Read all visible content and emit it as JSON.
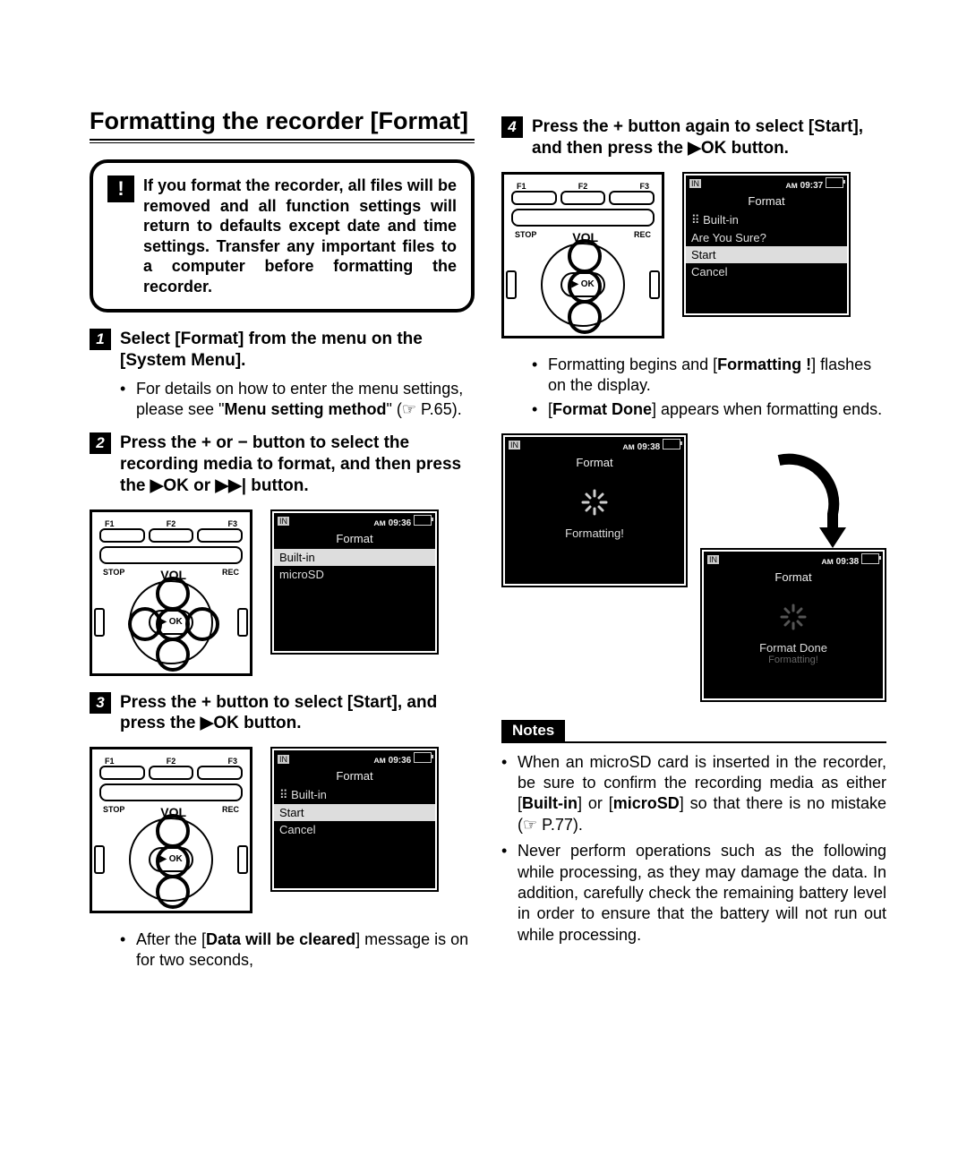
{
  "title": "Formatting the recorder [Format]",
  "warning_icon": "!",
  "warning": "If you format the recorder, all files will be removed and all function settings will return to defaults except date and time settings. Transfer any important files to a computer before formatting the recorder.",
  "steps": {
    "s1": {
      "num": "1",
      "text_parts": [
        "Select [",
        "Format",
        "] from the menu on the [",
        "System Menu",
        "]."
      ],
      "bullet_parts": [
        "For details on how to enter the menu settings, please see \"",
        "Menu setting method",
        "\" (☞ P.65)."
      ]
    },
    "s2": {
      "num": "2",
      "text_pre": "Press the + or − button to select the recording media to format, and then press the ",
      "text_ok": "OK",
      "text_mid": " or ",
      "text_post": " button."
    },
    "s3": {
      "num": "3",
      "text_pre": "Press the + button to select [Start], and press the ",
      "text_ok": "OK",
      "text_post": " button.",
      "bullet_parts": [
        "After the [",
        "Data will be cleared",
        "] message is on for two seconds,"
      ]
    },
    "s4": {
      "num": "4",
      "text_pre": "Press the + button again to select [Start], and then press the ",
      "text_ok": "OK",
      "text_post": " button.",
      "bullet1_parts": [
        "Formatting begins and [",
        "Formatting !",
        "] flashes on the display."
      ],
      "bullet2_parts": [
        "[",
        "Format Done",
        "] appears when formatting ends."
      ]
    }
  },
  "device": {
    "f1": "F1",
    "f2": "F2",
    "f3": "F3",
    "stop": "STOP",
    "rec": "REC",
    "vol": "VOL",
    "ok": "▶ OK"
  },
  "lcd_a": {
    "in": "IN",
    "time": "ᴀᴍ 09:36",
    "title": "Format",
    "row1": "Built-in",
    "row2": "microSD"
  },
  "lcd_b": {
    "in": "IN",
    "time": "ᴀᴍ 09:36",
    "title": "Format",
    "sub": "Built-in",
    "row1": "Start",
    "row2": "Cancel"
  },
  "lcd_c": {
    "in": "IN",
    "time": "ᴀᴍ 09:37",
    "title": "Format",
    "sub": "Built-in",
    "q": "Are You Sure?",
    "row1": "Start",
    "row2": "Cancel"
  },
  "lcd_d": {
    "in": "IN",
    "time": "ᴀᴍ 09:38",
    "title": "Format",
    "center": "Formatting!"
  },
  "lcd_e": {
    "in": "IN",
    "time": "ᴀᴍ 09:38",
    "title": "Format",
    "center": "Format Done",
    "sub": "Formatting!"
  },
  "notes_label": "Notes",
  "notes": {
    "n1_parts": [
      "When an microSD card is inserted in the recorder, be sure to confirm the recording media as either [",
      "Built-in",
      "] or [",
      "microSD",
      "] so that there is no mistake (☞ P.77)."
    ],
    "n2": "Never perform operations such as the following while processing, as they may damage the data. In addition, carefully check the remaining battery level in order to ensure that the battery will not run out while processing."
  }
}
